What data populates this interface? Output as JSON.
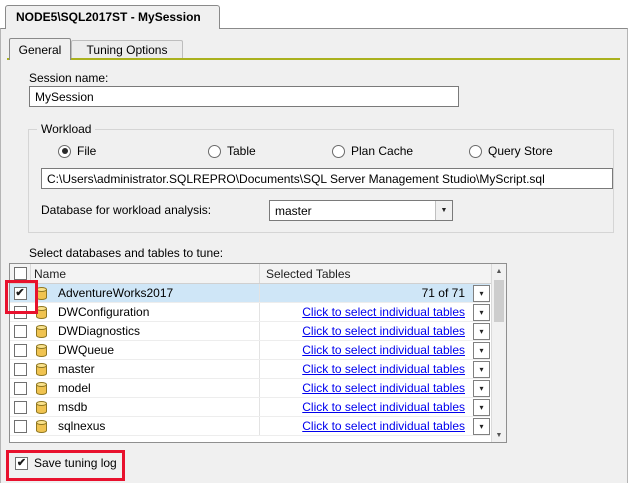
{
  "window": {
    "tab_title": "NODE5\\SQL2017ST - MySession"
  },
  "tabs": [
    {
      "label": "General"
    },
    {
      "label": "Tuning Options"
    }
  ],
  "general": {
    "session_name_label": "Session name:",
    "session_name_value": "MySession",
    "workload": {
      "group_label": "Workload",
      "options": [
        {
          "label": "File",
          "selected": true
        },
        {
          "label": "Table",
          "selected": false
        },
        {
          "label": "Plan Cache",
          "selected": false
        },
        {
          "label": "Query Store",
          "selected": false
        }
      ],
      "file_path": "C:\\Users\\administrator.SQLREPRO\\Documents\\SQL Server Management Studio\\MyScript.sql",
      "database_label": "Database for workload analysis:",
      "database_value": "master"
    },
    "tune_label": "Select databases and tables to tune:",
    "table": {
      "columns": [
        "Name",
        "Selected Tables"
      ],
      "rows": [
        {
          "name": "AdventureWorks2017",
          "checked": true,
          "highlighted": true,
          "link": false,
          "selected_tables": "71 of 71"
        },
        {
          "name": "DWConfiguration",
          "checked": false,
          "highlighted": false,
          "link": true,
          "selected_tables": "Click to select individual tables"
        },
        {
          "name": "DWDiagnostics",
          "checked": false,
          "highlighted": false,
          "link": true,
          "selected_tables": "Click to select individual tables"
        },
        {
          "name": "DWQueue",
          "checked": false,
          "highlighted": false,
          "link": true,
          "selected_tables": "Click to select individual tables"
        },
        {
          "name": "master",
          "checked": false,
          "highlighted": false,
          "link": true,
          "selected_tables": "Click to select individual tables"
        },
        {
          "name": "model",
          "checked": false,
          "highlighted": false,
          "link": true,
          "selected_tables": "Click to select individual tables"
        },
        {
          "name": "msdb",
          "checked": false,
          "highlighted": false,
          "link": true,
          "selected_tables": "Click to select individual tables"
        },
        {
          "name": "sqlnexus",
          "checked": false,
          "highlighted": false,
          "link": true,
          "selected_tables": "Click to select individual tables"
        }
      ]
    },
    "save_tuning_log_label": "Save tuning log",
    "save_tuning_log_checked": true
  },
  "colors": {
    "tab_accent": "#aab11e",
    "row_highlight": "#cfe6f7",
    "annotation": "#e8112d",
    "link": "#0000ee"
  }
}
